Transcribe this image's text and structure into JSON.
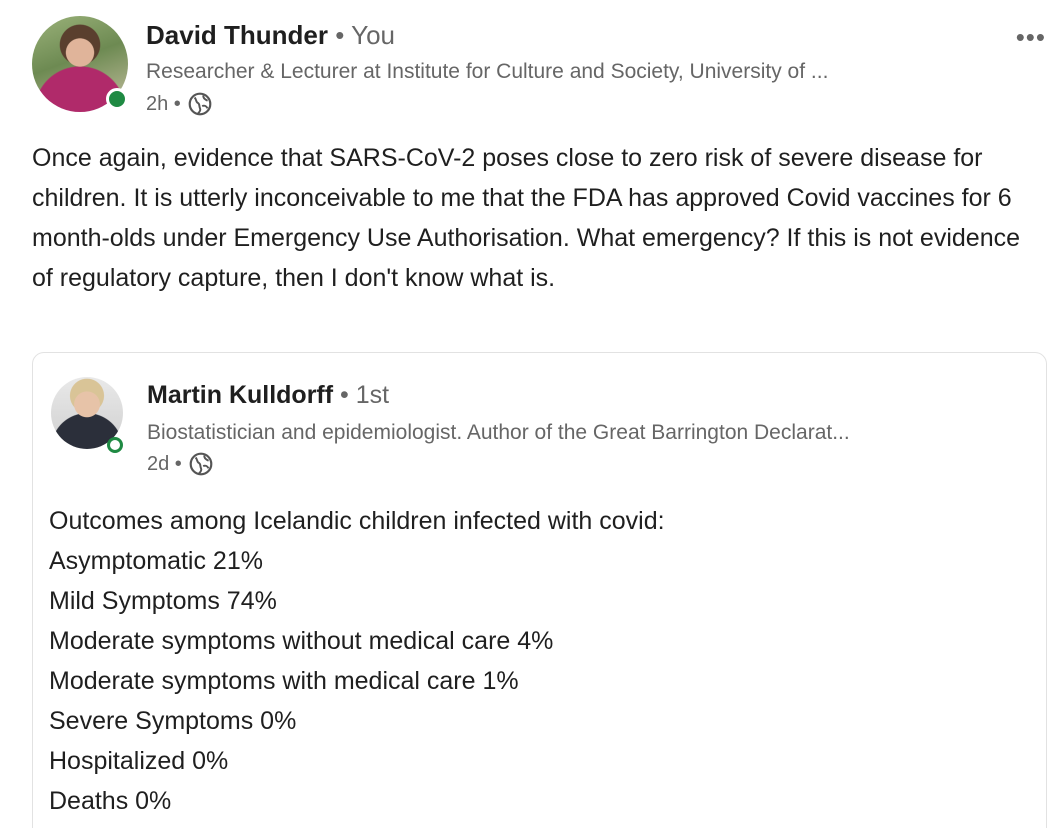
{
  "post": {
    "author": {
      "name": "David Thunder",
      "dot": " • ",
      "relation": "You",
      "headline": "Researcher & Lecturer at Institute for Culture and Society, University of ...",
      "time": "2h •",
      "presence_color": "#1f8a43"
    },
    "more_label": "•••",
    "text": "Once again, evidence that SARS-CoV-2 poses close to zero risk of severe disease for children. It is utterly inconceivable to me that the FDA has approved Covid vaccines for 6 month-olds under Emergency Use Authorisation. What emergency? If this is not evidence of regulatory capture, then I don't know what is."
  },
  "shared": {
    "author": {
      "name": "Martin Kulldorff",
      "dot": " • ",
      "degree": "1st",
      "headline": "Biostatistician and epidemiologist. Author of the Great Barrington Declarat...",
      "time": "2d •"
    },
    "lines": [
      "Outcomes among Icelandic children infected with covid:",
      "Asymptomatic 21%",
      "Mild Symptoms 74%",
      "Moderate symptoms without medical care 4%",
      "Moderate symptoms with medical care 1%",
      "Severe Symptoms 0%",
      "Hospitalized 0%",
      "Deaths 0%"
    ]
  },
  "icons": {
    "visibility": "globe-icon",
    "more": "more-options-icon"
  }
}
